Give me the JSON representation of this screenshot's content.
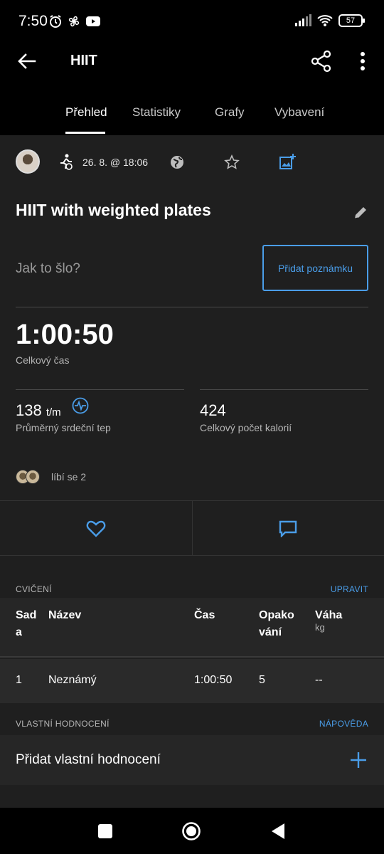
{
  "status": {
    "time": "7:50",
    "battery": "57"
  },
  "appbar": {
    "title": "HIIT"
  },
  "tabs": [
    {
      "label": "Přehled",
      "active": true
    },
    {
      "label": "Statistiky"
    },
    {
      "label": "Grafy"
    },
    {
      "label": "Vybavení"
    }
  ],
  "meta": {
    "date": "26. 8. @ 18:06"
  },
  "activity": {
    "title": "HIIT with weighted plates",
    "how_prompt": "Jak to šlo?",
    "add_note": "Přidat poznámku",
    "total_time": "1:00:50",
    "total_time_label": "Celkový čas",
    "hr_value": "138",
    "hr_unit": "t/m",
    "hr_label": "Průměrný srdeční tep",
    "calories_value": "424",
    "calories_label": "Celkový počet kalorií",
    "likes_text": "líbí se 2"
  },
  "exercises": {
    "header": "CVIČENÍ",
    "edit": "UPRAVIT",
    "columns": {
      "set_line1": "Sad",
      "set_line2": "a",
      "name": "Název",
      "time": "Čas",
      "reps_line1": "Opako",
      "reps_line2": "vání",
      "weight": "Váha",
      "weight_unit": "kg"
    },
    "rows": [
      {
        "set": "1",
        "name": "Neznámý",
        "time": "1:00:50",
        "reps": "5",
        "weight": "--"
      }
    ]
  },
  "custom_rating": {
    "header": "VLASTNÍ HODNOCENÍ",
    "help": "NÁPOVĚDA",
    "add_label": "Přidat vlastní hodnocení"
  },
  "colors": {
    "accent": "#4a9de8",
    "background": "#1f1f1f"
  }
}
